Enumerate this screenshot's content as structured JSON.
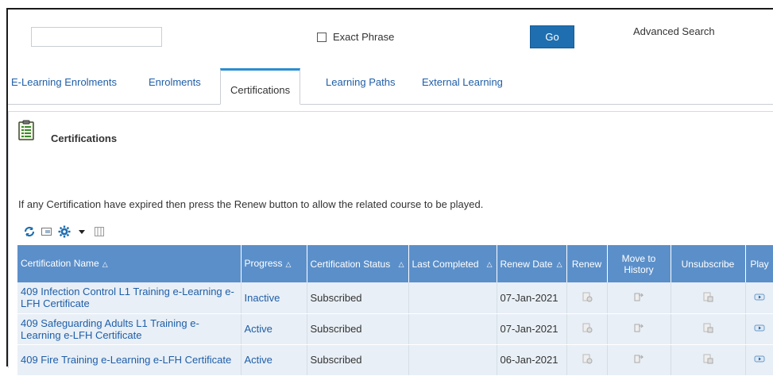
{
  "search": {
    "input_value": "",
    "exact_phrase_label": "Exact Phrase",
    "exact_phrase_checked": false,
    "go_label": "Go",
    "advanced_label": "Advanced Search"
  },
  "tabs": [
    {
      "label": "E-Learning Enrolments",
      "selected": false
    },
    {
      "label": "Enrolments",
      "selected": false
    },
    {
      "label": "Certifications",
      "selected": true
    },
    {
      "label": "Learning Paths",
      "selected": false
    },
    {
      "label": "External Learning",
      "selected": false
    }
  ],
  "section": {
    "title": "Certifications",
    "icon": "clipboard-icon",
    "info": "If any Certification have expired then press the Renew button to allow the related course to be played."
  },
  "toolbar": {
    "icons": [
      "refresh-icon",
      "export-icon",
      "settings-icon",
      "dropdown-arrow-icon",
      "columns-icon"
    ]
  },
  "table": {
    "headers": {
      "name": "Certification Name",
      "progress": "Progress",
      "status": "Certification Status",
      "last_completed": "Last Completed",
      "renew_date": "Renew Date",
      "renew": "Renew",
      "move_history": "Move to History",
      "unsubscribe": "Unsubscribe",
      "play": "Play"
    },
    "rows": [
      {
        "name": "409 Infection Control L1 Training e-Learning e-LFH Certificate",
        "progress": "Inactive",
        "status": "Subscribed",
        "last_completed": "",
        "renew_date": "07-Jan-2021"
      },
      {
        "name": "409 Safeguarding Adults L1 Training e-Learning e-LFH Certificate",
        "progress": "Active",
        "status": "Subscribed",
        "last_completed": "",
        "renew_date": "07-Jan-2021"
      },
      {
        "name": "409 Fire Training e-Learning e-LFH Certificate",
        "progress": "Active",
        "status": "Subscribed",
        "last_completed": "",
        "renew_date": "06-Jan-2021"
      }
    ]
  },
  "colors": {
    "header_bg": "#5b8fc9",
    "row_bg": "#e8eff6",
    "link": "#1f5ea8",
    "go_button": "#1f6fb0",
    "tab_accent": "#2a8ecf"
  }
}
